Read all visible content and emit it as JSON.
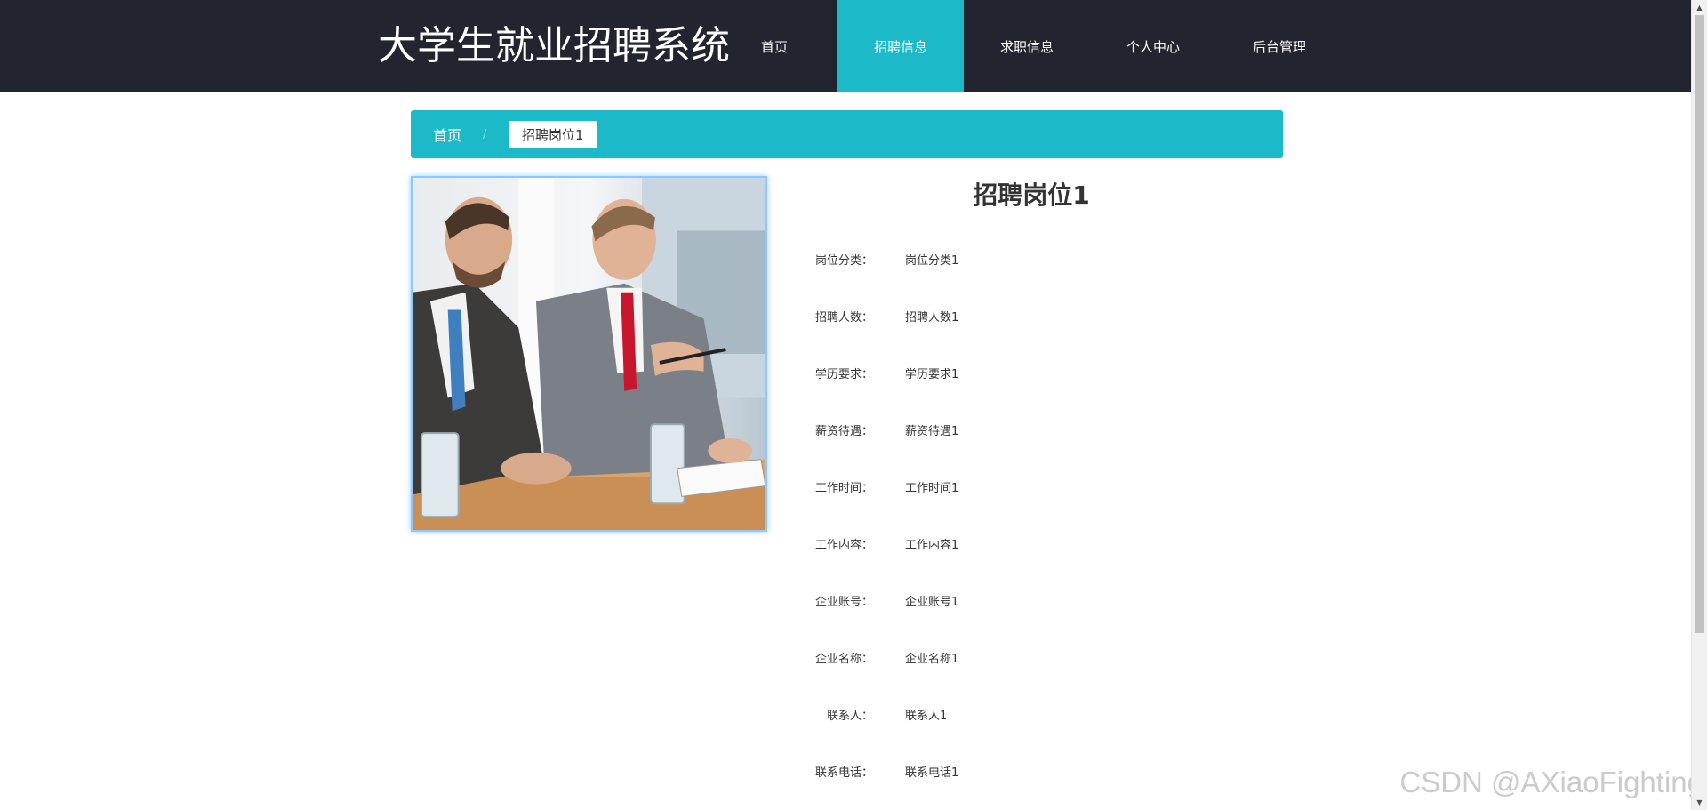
{
  "header": {
    "site_title": "大学生就业招聘系统",
    "nav": [
      {
        "label": "首页",
        "active": false
      },
      {
        "label": "招聘信息",
        "active": true
      },
      {
        "label": "求职信息",
        "active": false
      },
      {
        "label": "个人中心",
        "active": false
      },
      {
        "label": "后台管理",
        "active": false
      }
    ]
  },
  "breadcrumb": {
    "home": "首页",
    "separator": "/",
    "current": "招聘岗位1"
  },
  "detail": {
    "title": "招聘岗位1",
    "fields": [
      {
        "label": "岗位分类：",
        "value": "岗位分类1"
      },
      {
        "label": "招聘人数：",
        "value": "招聘人数1"
      },
      {
        "label": "学历要求：",
        "value": "学历要求1"
      },
      {
        "label": "薪资待遇：",
        "value": "薪资待遇1"
      },
      {
        "label": "工作时间：",
        "value": "工作时间1"
      },
      {
        "label": "工作内容：",
        "value": "工作内容1"
      },
      {
        "label": "企业账号：",
        "value": "企业账号1"
      },
      {
        "label": "企业名称：",
        "value": "企业名称1"
      },
      {
        "label": "联系人：",
        "value": "联系人1"
      },
      {
        "label": "联系电话：",
        "value": "联系电话1"
      }
    ]
  },
  "watermark": "CSDN @AXiaoFighting",
  "colors": {
    "header_bg": "#22252f",
    "accent": "#1cbac9",
    "text": "#333333"
  }
}
